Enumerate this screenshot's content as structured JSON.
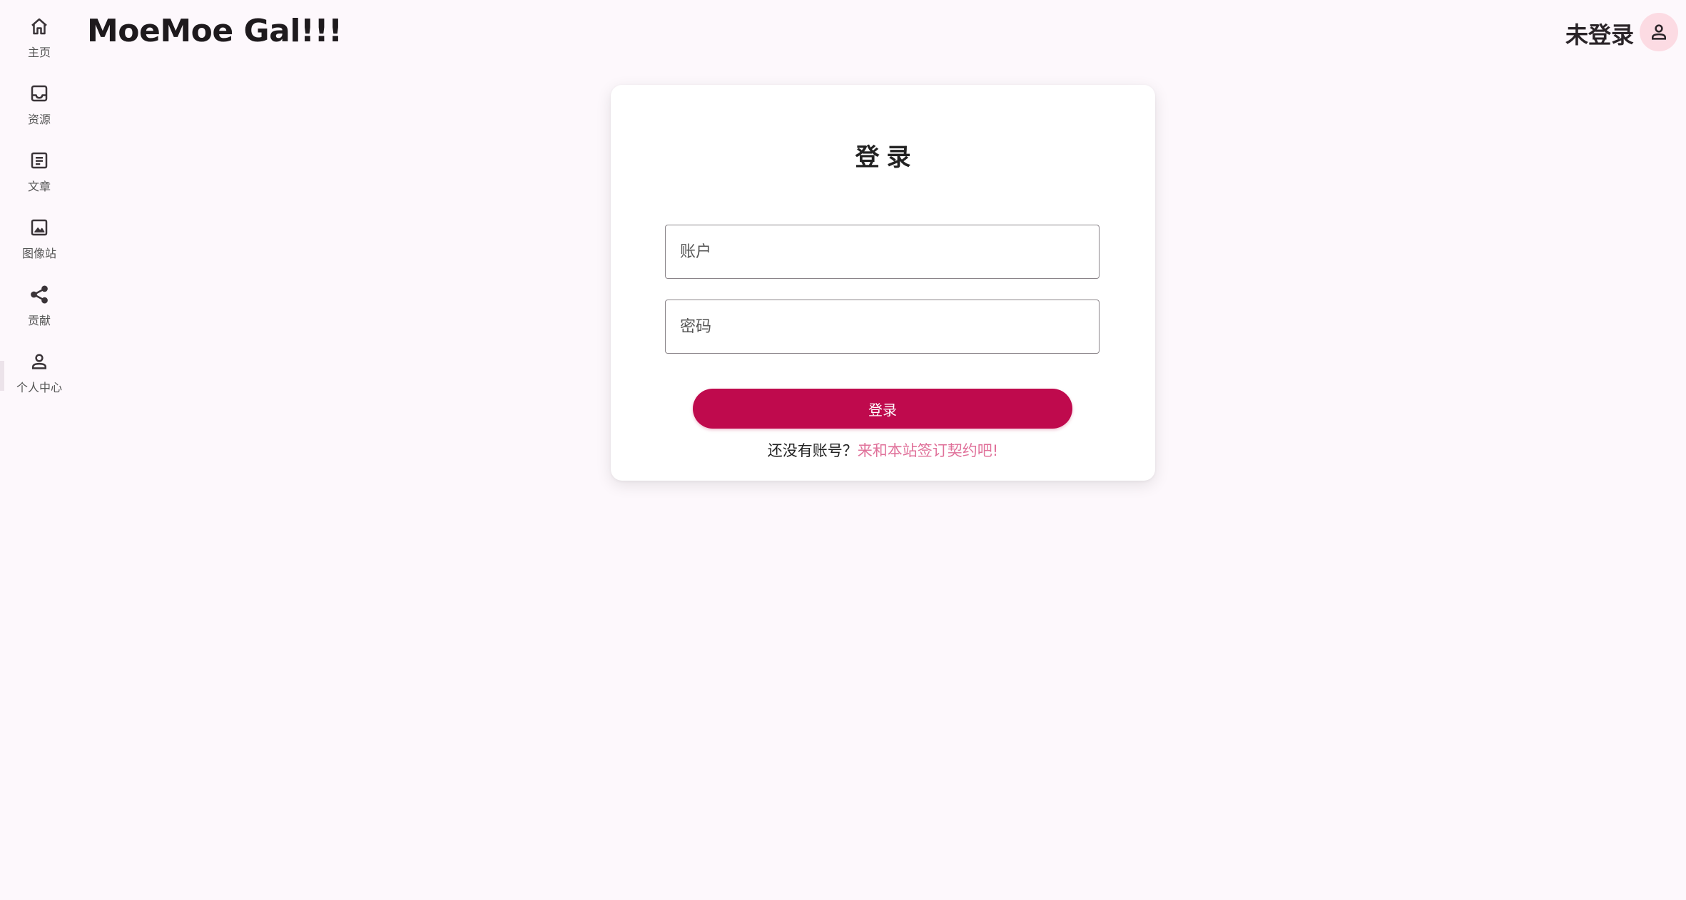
{
  "app": {
    "title": "MoeMoe Gal!!!"
  },
  "sidebar": {
    "items": [
      {
        "label": "主页",
        "icon": "home-icon"
      },
      {
        "label": "资源",
        "icon": "inbox-icon"
      },
      {
        "label": "文章",
        "icon": "article-icon"
      },
      {
        "label": "图像站",
        "icon": "image-icon"
      },
      {
        "label": "贡献",
        "icon": "share-icon"
      },
      {
        "label": "个人中心",
        "icon": "person-icon",
        "active": true
      }
    ]
  },
  "header": {
    "user_status": "未登录",
    "avatar_icon": "person-icon"
  },
  "login": {
    "title": "登录",
    "account_placeholder": "账户",
    "password_placeholder": "密码",
    "submit_label": "登录",
    "register_prompt": "还没有账号？",
    "register_link": "来和本站签订契约吧!"
  },
  "colors": {
    "background": "#fdf8fc",
    "primary": "#bf0a4d",
    "link": "#e0719a",
    "avatar_bg": "#fcdbe3"
  }
}
